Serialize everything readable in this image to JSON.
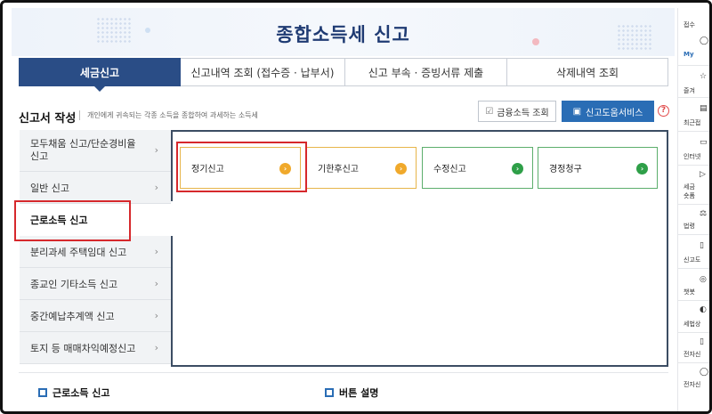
{
  "header": {
    "title": "종합소득세 신고"
  },
  "top_tabs": [
    {
      "label": "세금신고",
      "active": true
    },
    {
      "label": "신고내역 조회 (접수증 · 납부서)",
      "active": false
    },
    {
      "label": "신고 부속 · 증빙서류 제출",
      "active": false
    },
    {
      "label": "삭제내역 조회",
      "active": false
    }
  ],
  "section": {
    "title": "신고서 작성",
    "description": "개인에게 귀속되는 각종 소득을 종합하여 과세하는 소득세",
    "btn_financial": "금융소득 조회",
    "btn_help_service": "신고도움서비스",
    "help_icon": "?"
  },
  "left_menu": [
    {
      "label": "모두채움 신고/단순경비율 신고",
      "chevron": "›"
    },
    {
      "label": "일반 신고",
      "chevron": "›"
    },
    {
      "label": "근로소득 신고",
      "active": true
    },
    {
      "label": "분리과세 주택임대 신고",
      "chevron": "›"
    },
    {
      "label": "종교인 기타소득 신고",
      "chevron": "›"
    },
    {
      "label": "중간예납추계액 신고",
      "chevron": "›"
    },
    {
      "label": "토지 등 매매차익예정신고",
      "chevron": "›"
    }
  ],
  "cards": [
    {
      "label": "정기신고",
      "color": "#f0a92b",
      "icon": "›"
    },
    {
      "label": "기한후신고",
      "color": "#f0a92b",
      "icon": "›"
    },
    {
      "label": "수정신고",
      "color": "#2e9f48",
      "icon": "›"
    },
    {
      "label": "경정청구",
      "color": "#2e9f48",
      "icon": "›"
    }
  ],
  "bottom": {
    "left_label": "근로소득 신고",
    "right_label": "버튼 설명"
  },
  "right_sidebar": [
    {
      "label": "접수"
    },
    {
      "label": "My"
    },
    {
      "label": "즐겨"
    },
    {
      "label": "최근접"
    },
    {
      "label": "인터넷"
    },
    {
      "label": "세금"
    },
    {
      "label": "숏폼"
    },
    {
      "label": "법령"
    },
    {
      "label": "신고도"
    },
    {
      "label": "챗봇"
    },
    {
      "label": "세법상"
    },
    {
      "label": "전자신"
    },
    {
      "label": "전자신"
    }
  ],
  "colors": {
    "primary": "#2a4d86",
    "accent": "#2a6db5",
    "highlight": "#d6282c",
    "orange": "#f0a92b",
    "green": "#2e9f48"
  }
}
